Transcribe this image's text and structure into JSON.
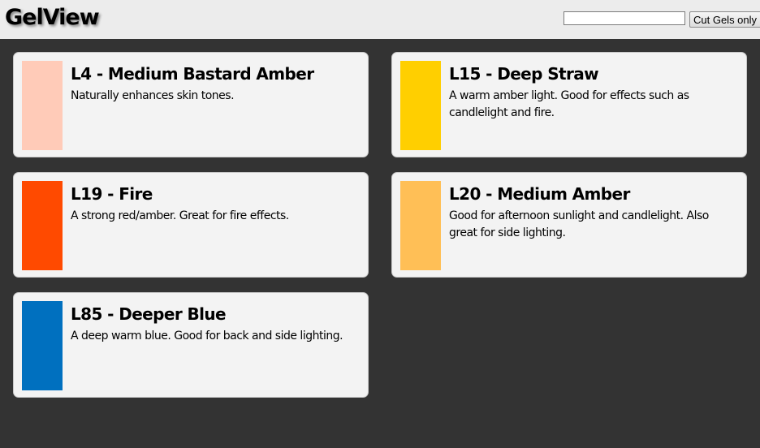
{
  "header": {
    "title": "GelView",
    "search": {
      "value": "",
      "placeholder": ""
    },
    "filter_button_label": "Cut Gels only"
  },
  "gels": [
    {
      "name": "L4 - Medium Bastard Amber",
      "description": "Naturally enhances skin tones.",
      "color": "#ffcbb8"
    },
    {
      "name": "L15 - Deep Straw",
      "description": "A warm amber light. Good for effects such as candlelight and fire.",
      "color": "#ffcf00"
    },
    {
      "name": "L19 - Fire",
      "description": "A strong red/amber. Great for fire effects.",
      "color": "#ff4a00"
    },
    {
      "name": "L20 - Medium Amber",
      "description": "Good for afternoon sunlight and candlelight. Also great for side lighting.",
      "color": "#ffbf56"
    },
    {
      "name": "L85 - Deeper Blue",
      "description": "A deep warm blue. Good for back and side lighting.",
      "color": "#0070bf"
    }
  ],
  "colors": {
    "page_background": "#333333",
    "header_background": "#ececec",
    "card_background": "#f3f3f3"
  }
}
